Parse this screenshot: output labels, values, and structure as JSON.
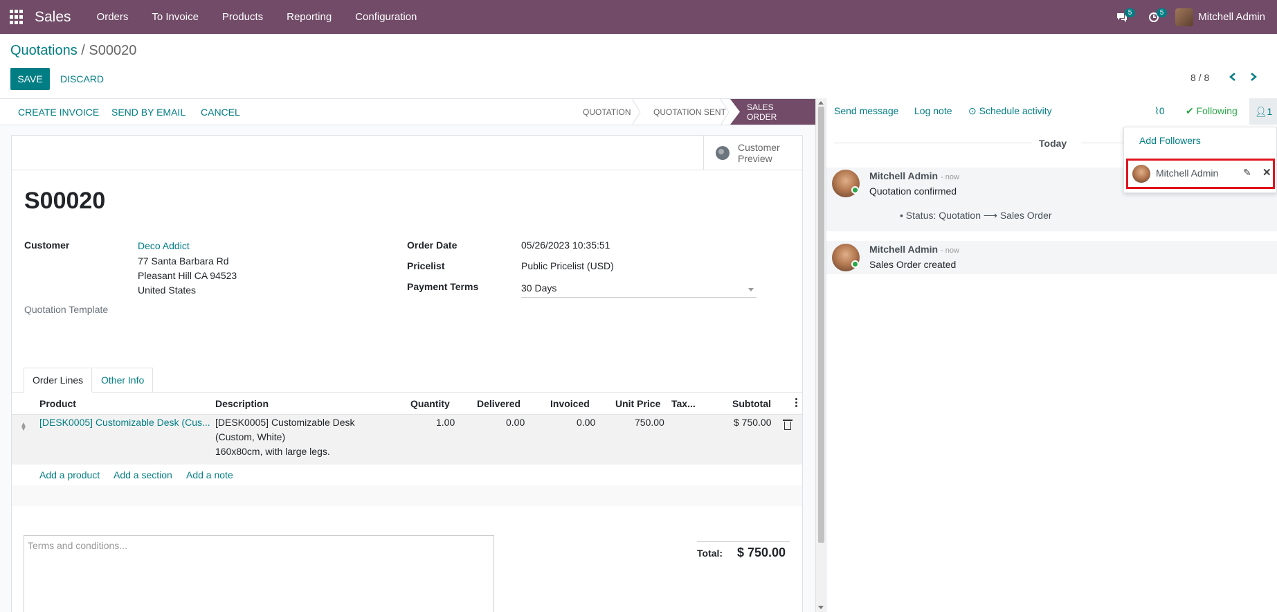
{
  "navbar": {
    "app_name": "Sales",
    "menu": [
      "Orders",
      "To Invoice",
      "Products",
      "Reporting",
      "Configuration"
    ],
    "messages_badge": "5",
    "activities_badge": "5",
    "user_name": "Mitchell Admin"
  },
  "breadcrumb": {
    "parent": "Quotations",
    "separator": " / ",
    "current": "S00020"
  },
  "actions": {
    "save": "SAVE",
    "discard": "DISCARD"
  },
  "pager": {
    "value": "8 / 8"
  },
  "statusbar": {
    "buttons": [
      "CREATE INVOICE",
      "SEND BY EMAIL",
      "CANCEL"
    ],
    "stages": [
      "QUOTATION",
      "QUOTATION SENT",
      "SALES ORDER"
    ],
    "active_stage": "SALES ORDER"
  },
  "form": {
    "preview_line1": "Customer",
    "preview_line2": "Preview",
    "name": "S00020",
    "customer_label": "Customer",
    "customer_name": "Deco Addict",
    "address_line1": "77 Santa Barbara Rd",
    "address_line2": "Pleasant Hill CA 94523",
    "address_line3": "United States",
    "quotation_template_label": "Quotation Template",
    "order_date_label": "Order Date",
    "order_date": "05/26/2023 10:35:51",
    "pricelist_label": "Pricelist",
    "pricelist": "Public Pricelist (USD)",
    "payment_terms_label": "Payment Terms",
    "payment_terms": "30 Days"
  },
  "tabs": [
    "Order Lines",
    "Other Info"
  ],
  "order_lines": {
    "columns": [
      "Product",
      "Description",
      "Quantity",
      "Delivered",
      "Invoiced",
      "Unit Price",
      "Tax...",
      "Subtotal"
    ],
    "rows": [
      {
        "product": "[DESK0005] Customizable Desk (Cus...",
        "description_1": "[DESK0005] Customizable Desk",
        "description_2": "(Custom, White)",
        "description_3": "160x80cm, with large legs.",
        "quantity": "1.00",
        "delivered": "0.00",
        "invoiced": "0.00",
        "unit_price": "750.00",
        "subtotal": "$ 750.00"
      }
    ],
    "add_product": "Add a product",
    "add_section": "Add a section",
    "add_note": "Add a note"
  },
  "terms_placeholder": "Terms and conditions...",
  "total": {
    "label": "Total:",
    "value": "$ 750.00"
  },
  "chatter": {
    "send_message": "Send message",
    "log_note": "Log note",
    "schedule_activity": "Schedule activity",
    "attachments_count": "0",
    "following": "Following",
    "followers_count": "1",
    "date_separator": "Today",
    "messages": [
      {
        "author": "Mitchell Admin",
        "time": "- now",
        "body": "Quotation confirmed",
        "tracking": "Status: Quotation ⟶ Sales Order"
      },
      {
        "author": "Mitchell Admin",
        "time": "- now",
        "body": "Sales Order created"
      }
    ]
  },
  "followers_dropdown": {
    "add_followers": "Add Followers",
    "follower_name": "Mitchell Admin"
  },
  "colors": {
    "brand": "#714b67",
    "accent": "#017e84",
    "following": "#28a745",
    "highlight": "#e0141e"
  }
}
